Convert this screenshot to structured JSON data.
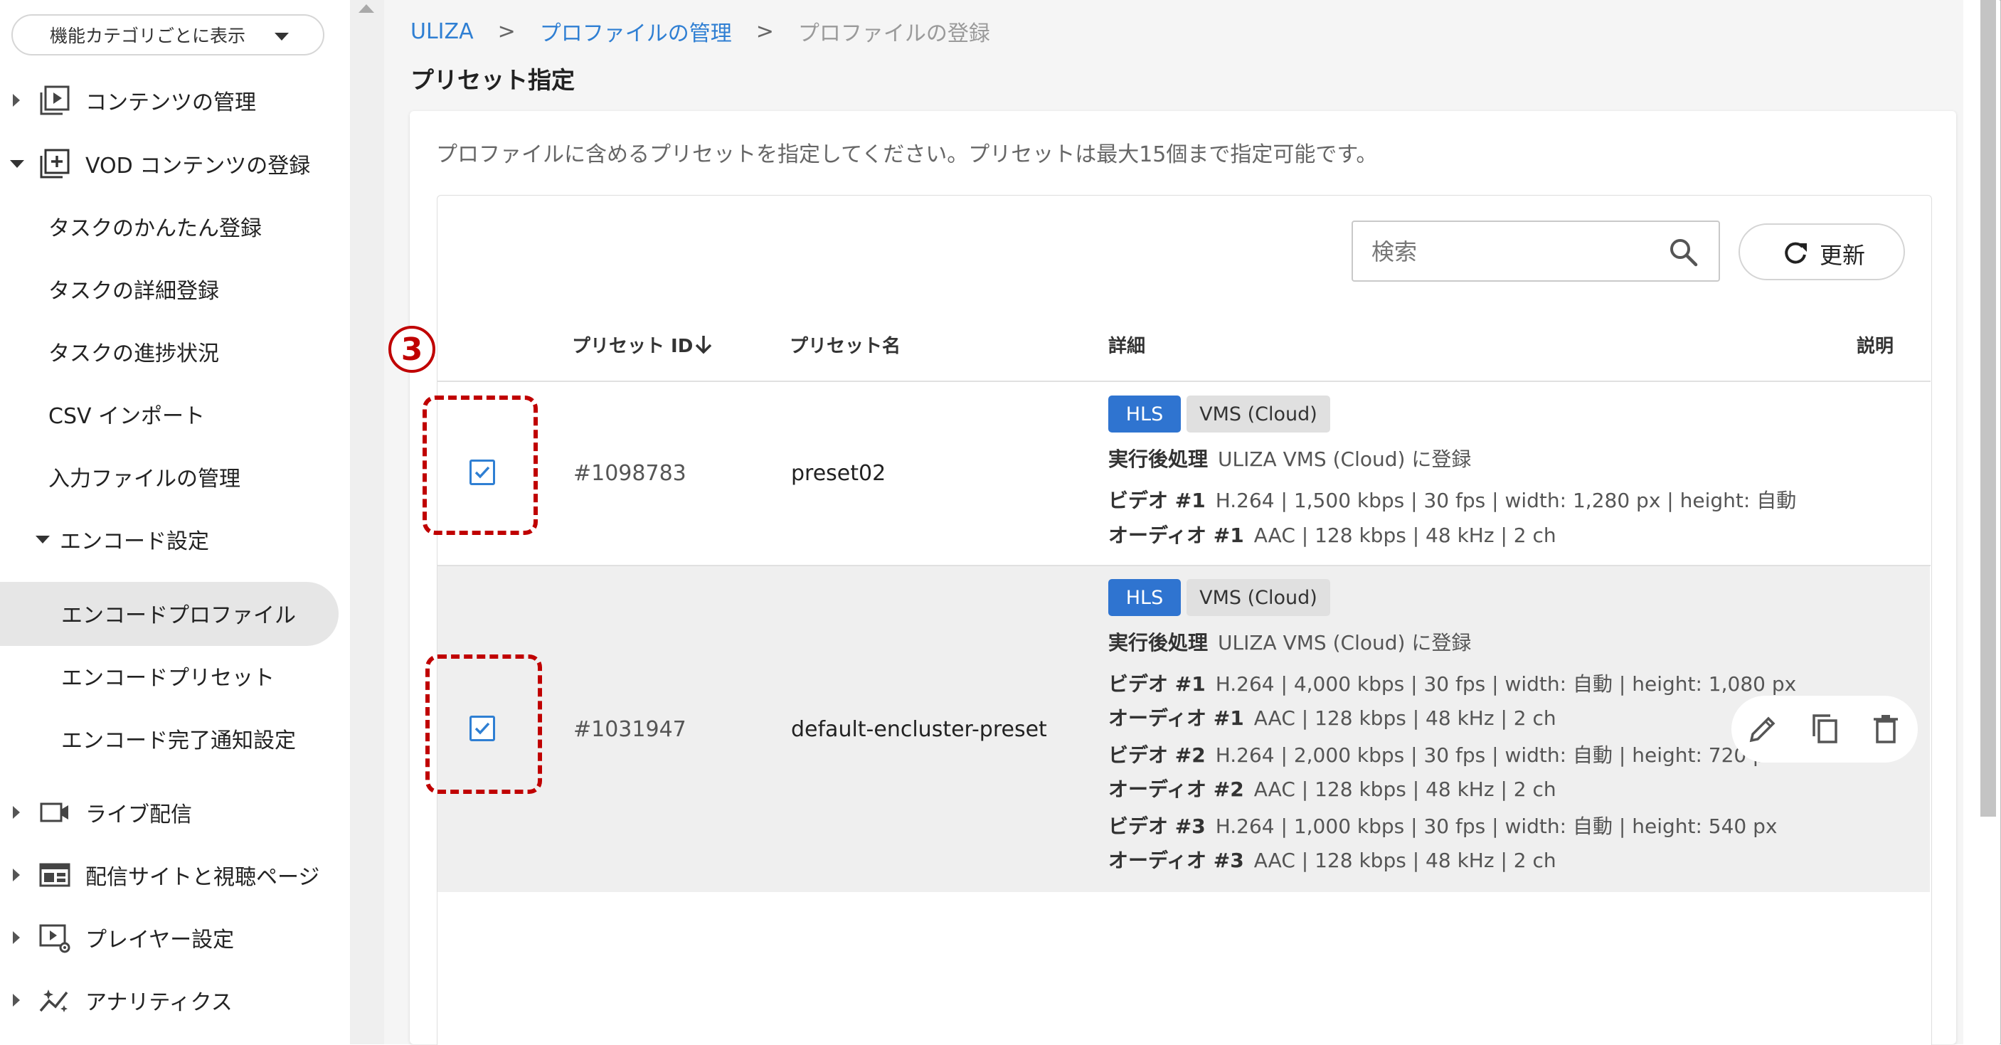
{
  "sidebar": {
    "category_select": "機能カテゴリごとに表示",
    "items": [
      {
        "label": "コンテンツの管理",
        "icon": "content-library-icon"
      },
      {
        "label": "VOD コンテンツの登録",
        "icon": "add-box-icon"
      },
      {
        "label": "タスクのかんたん登録"
      },
      {
        "label": "タスクの詳細登録"
      },
      {
        "label": "タスクの進捗状況"
      },
      {
        "label": "CSV インポート"
      },
      {
        "label": "入力ファイルの管理"
      },
      {
        "label": "エンコード設定"
      },
      {
        "label": "エンコードプロファイル"
      },
      {
        "label": "エンコードプリセット"
      },
      {
        "label": "エンコード完了通知設定"
      },
      {
        "label": "ライブ配信",
        "icon": "video-camera-icon"
      },
      {
        "label": "配信サイトと視聴ページ",
        "icon": "web-layout-icon"
      },
      {
        "label": "プレイヤー設定",
        "icon": "player-settings-icon"
      },
      {
        "label": "アナリティクス",
        "icon": "analytics-icon"
      }
    ],
    "active_item": "エンコードプロファイル"
  },
  "breadcrumb": {
    "items": [
      "ULIZA",
      "プロファイルの管理",
      "プロファイルの登録"
    ],
    "separator": ">"
  },
  "page_title": "プリセット指定",
  "description": "プロファイルに含めるプリセットを指定してください。プリセットは最大15個まで指定可能です。",
  "toolbar": {
    "search_placeholder": "検索",
    "refresh_label": "更新"
  },
  "table": {
    "columns": {
      "id": "プリセット ID",
      "name": "プリセット名",
      "detail": "詳細",
      "note": "説明"
    },
    "sort": {
      "column": "id",
      "direction": "descending"
    },
    "rows": [
      {
        "checked": true,
        "id": "#1098783",
        "name": "preset02",
        "badges": [
          "HLS",
          "VMS (Cloud)"
        ],
        "post_label": "実行後処理",
        "post_value": "ULIZA VMS (Cloud) に登録",
        "tracks": [
          {
            "label": "ビデオ #1",
            "value": "H.264 | 1,500 kbps | 30 fps | width: 1,280 px | height: 自動"
          },
          {
            "label": "オーディオ #1",
            "value": "AAC | 128 kbps | 48 kHz | 2 ch"
          }
        ]
      },
      {
        "checked": true,
        "id": "#1031947",
        "name": "default-encluster-preset",
        "badges": [
          "HLS",
          "VMS (Cloud)"
        ],
        "post_label": "実行後処理",
        "post_value": "ULIZA VMS (Cloud) に登録",
        "tracks": [
          {
            "label": "ビデオ #1",
            "value": "H.264 | 4,000 kbps | 30 fps | width: 自動 | height: 1,080 px"
          },
          {
            "label": "オーディオ #1",
            "value": "AAC | 128 kbps | 48 kHz | 2 ch"
          },
          {
            "label": "ビデオ #2",
            "value": "H.264 | 2,000 kbps | 30 fps | width: 自動 | height: 720 px"
          },
          {
            "label": "オーディオ #2",
            "value": "AAC | 128 kbps | 48 kHz | 2 ch"
          },
          {
            "label": "ビデオ #3",
            "value": "H.264 | 1,000 kbps | 30 fps | width: 自動 | height: 540 px"
          },
          {
            "label": "オーディオ #3",
            "value": "AAC | 128 kbps | 48 kHz | 2 ch"
          }
        ],
        "row_actions": [
          "edit-icon",
          "copy-icon",
          "delete-icon"
        ]
      }
    ]
  },
  "annotation": {
    "step_number": "3"
  },
  "colors": {
    "accent": "#2f7fd3",
    "badge_hls": "#2f74d0",
    "annotation_red": "#c00000"
  }
}
